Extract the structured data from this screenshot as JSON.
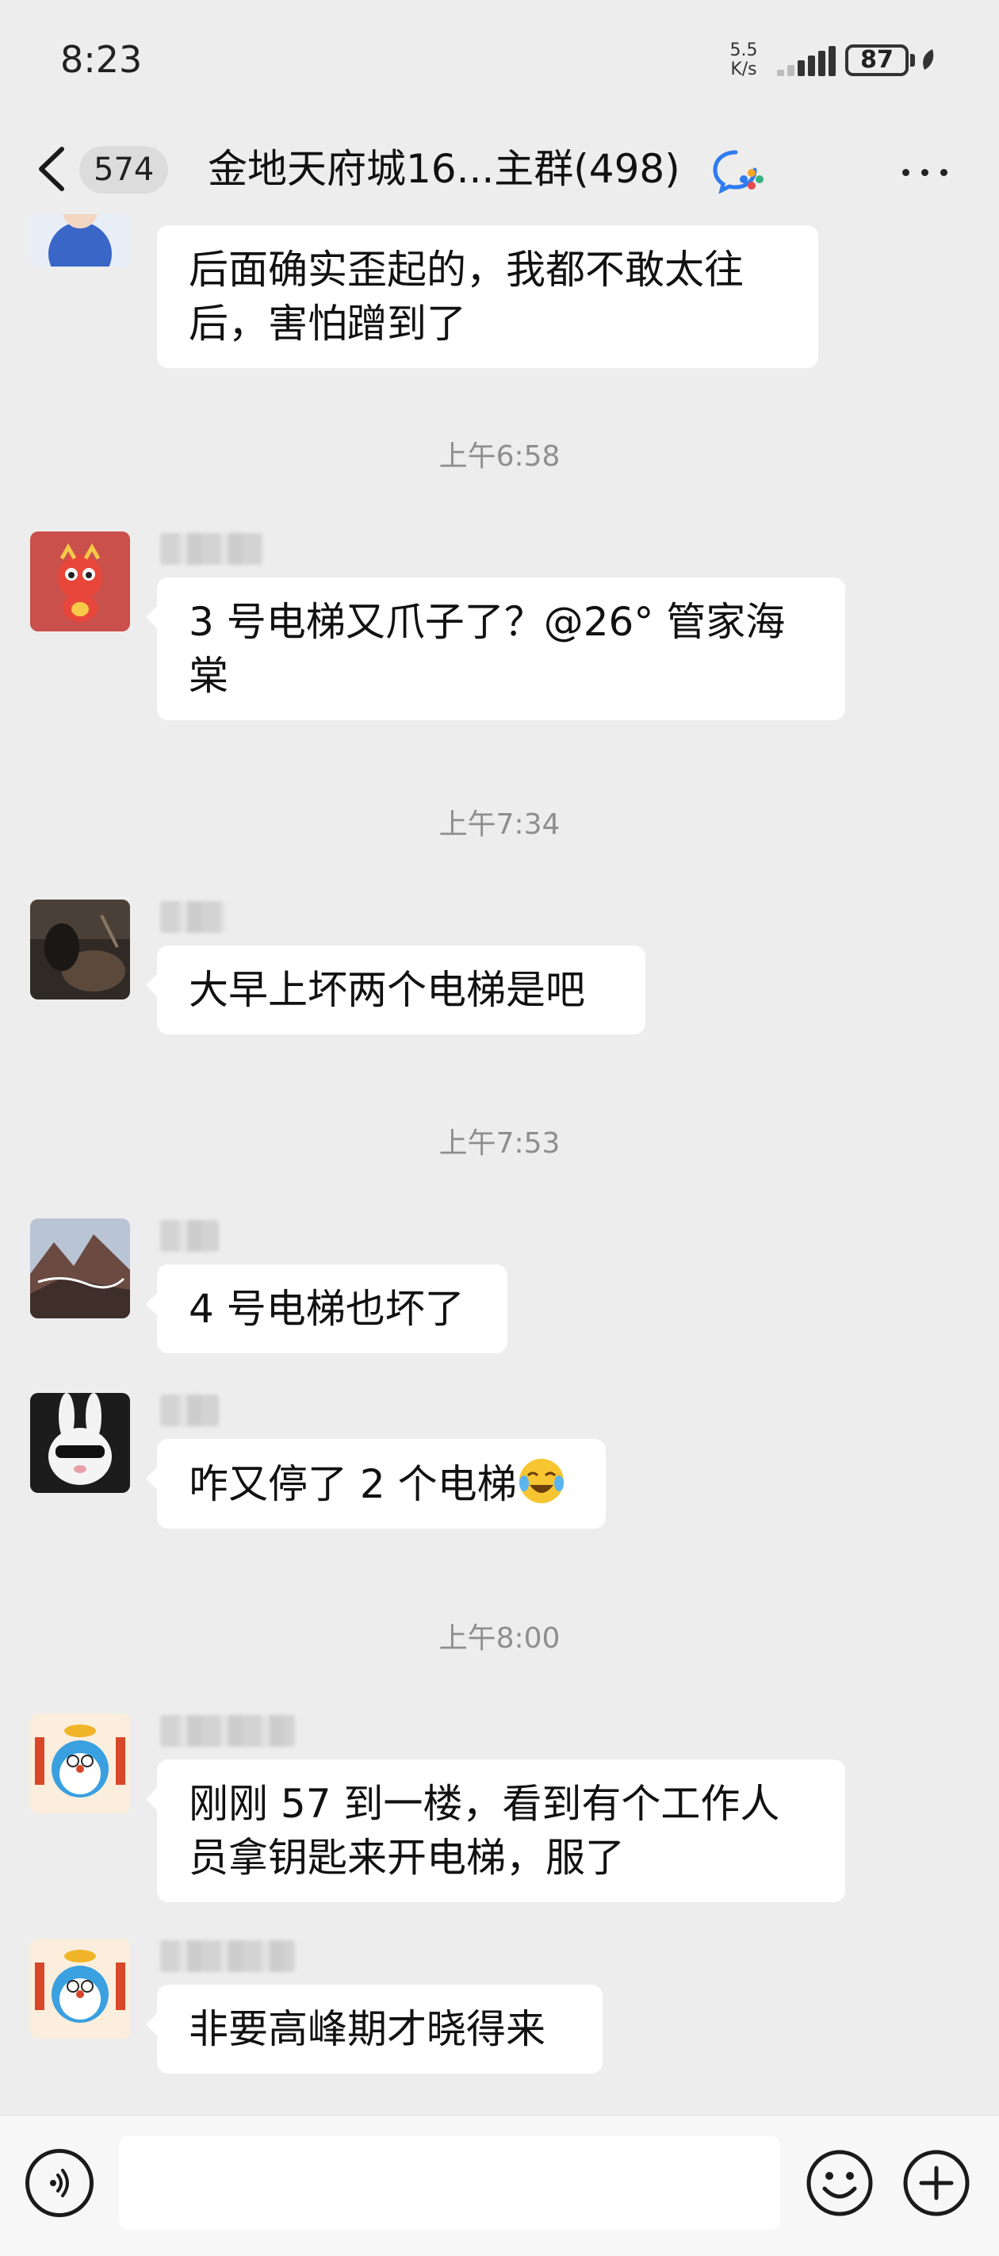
{
  "status_bar": {
    "time": "8:23",
    "net_speed_value": "5.5",
    "net_speed_unit": "K/s",
    "battery": "87"
  },
  "header": {
    "unread_count": "574",
    "title": "金地天府城16...主群(498)"
  },
  "messages": {
    "m0": {
      "text": "后面确实歪起的，我都不敢太往后，害怕蹭到了"
    },
    "t1": "上午6:58",
    "m1": {
      "text": "3 号电梯又爪子了？@26° 管家海棠"
    },
    "t2": "上午7:34",
    "m2": {
      "text": "大早上坏两个电梯是吧"
    },
    "t3": "上午7:53",
    "m3": {
      "text": "4 号电梯也坏了"
    },
    "m4": {
      "text": "咋又停了 2 个电梯",
      "emoji": "crying-laughing-emoji"
    },
    "t4": "上午8:00",
    "m5": {
      "text": "刚刚 57 到一楼，看到有个工作人员拿钥匙来开电梯，服了"
    },
    "m6": {
      "text": "非要高峰期才晓得来"
    }
  },
  "input_bar": {
    "placeholder": "",
    "icons": [
      "voice-icon",
      "emoji-icon",
      "plus-icon"
    ]
  },
  "colors": {
    "background": "#ededed",
    "bubble": "#ffffff",
    "timestamp": "#8e8e8e",
    "input_bar": "#f7f7f7"
  }
}
